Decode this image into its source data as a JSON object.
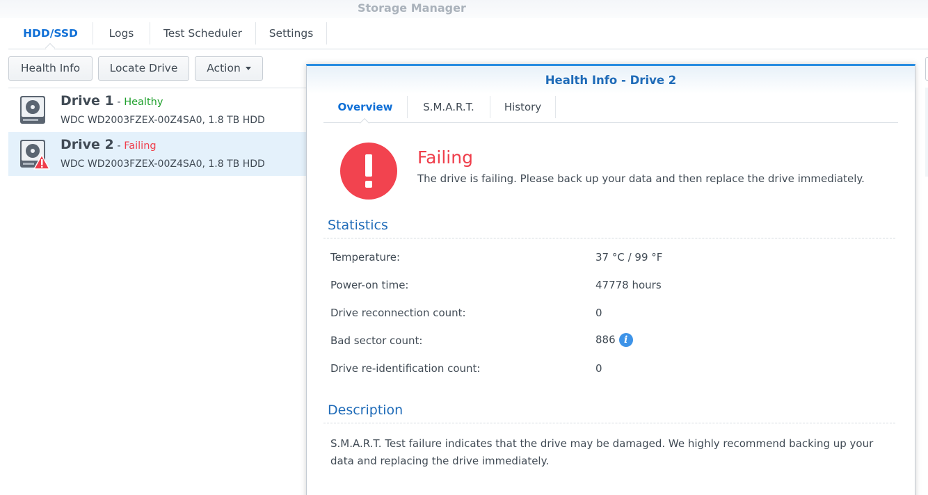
{
  "app": {
    "title": "Storage Manager"
  },
  "tabs": [
    "HDD/SSD",
    "Logs",
    "Test Scheduler",
    "Settings"
  ],
  "toolbar": {
    "health_info": "Health Info",
    "locate_drive": "Locate Drive",
    "action": "Action"
  },
  "drives": [
    {
      "name": "Drive 1",
      "separator": " - ",
      "status": "Healthy",
      "status_color": "#1fa02c",
      "model": "WDC WD2003FZEX-00Z4SA0, 1.8 TB HDD"
    },
    {
      "name": "Drive 2",
      "separator": " - ",
      "status": "Failing",
      "status_color": "#ef3e4b",
      "model": "WDC WD2003FZEX-00Z4SA0, 1.8 TB HDD"
    }
  ],
  "dialog": {
    "title": "Health Info - Drive 2",
    "tabs": [
      "Overview",
      "S.M.A.R.T.",
      "History"
    ],
    "status_title": "Failing",
    "status_message": "The drive is failing. Please back up your data and then replace the drive immediately.",
    "statistics_title": "Statistics",
    "stats": [
      {
        "label": "Temperature:",
        "value": "37 °C / 99 °F"
      },
      {
        "label": "Power-on time:",
        "value": "47778 hours"
      },
      {
        "label": "Drive reconnection count:",
        "value": "0"
      },
      {
        "label": "Bad sector count:",
        "value": "886"
      },
      {
        "label": "Drive re-identification count:",
        "value": "0"
      }
    ],
    "info_icon": "i",
    "description_title": "Description",
    "description": "S.M.A.R.T. Test failure indicates that the drive may be damaged. We highly recommend backing up your data and replacing the drive immediately."
  },
  "colors": {
    "accent": "#0f6fd6",
    "danger": "#ef3e4b",
    "healthy": "#1fa02c",
    "selected_row": "#e4f1fb"
  }
}
